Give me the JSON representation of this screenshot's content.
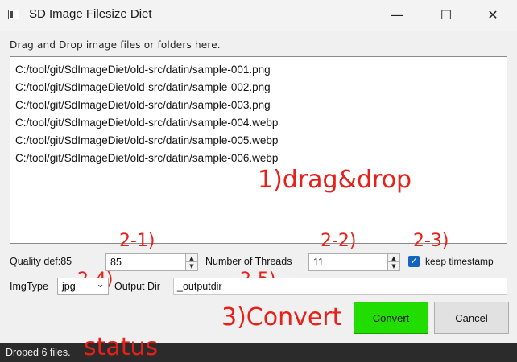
{
  "window": {
    "title": "SD Image Filesize Diet",
    "minimize_glyph": "—",
    "maximize_glyph": "☐",
    "close_glyph": "✕"
  },
  "drop_area": {
    "instruction": "Drag and Drop image files or folders here.",
    "files": [
      "C:/tool/git/SdImageDiet/old-src/datin/sample-001.png",
      "C:/tool/git/SdImageDiet/old-src/datin/sample-002.png",
      "C:/tool/git/SdImageDiet/old-src/datin/sample-003.png",
      "C:/tool/git/SdImageDiet/old-src/datin/sample-004.webp",
      "C:/tool/git/SdImageDiet/old-src/datin/sample-005.webp",
      "C:/tool/git/SdImageDiet/old-src/datin/sample-006.webp"
    ]
  },
  "annotations": {
    "drag_drop": "1)drag&drop",
    "quality": "2-1)",
    "threads": "2-2)",
    "timestamp": "2-3)",
    "imgtype": "2-4)",
    "outputdir": "2-5)",
    "convert": "3)Convert",
    "status": "status"
  },
  "settings": {
    "quality_label": "Quality def:85",
    "quality_value": "85",
    "threads_label": "Number of Threads",
    "threads_value": "11",
    "keep_timestamp_label": "keep timestamp",
    "keep_timestamp_checked": true,
    "imgtype_label": "ImgType",
    "imgtype_value": "jpg",
    "output_dir_label": "Output Dir",
    "output_dir_value": "_outputdir"
  },
  "actions": {
    "convert_label": "Convert",
    "cancel_label": "Cancel"
  },
  "status": {
    "text": "Droped 6 files."
  },
  "colors": {
    "annotation": "#e8201a",
    "convert_button": "#22dd00",
    "checkbox": "#1565c0",
    "statusbar": "#2b2b2b"
  },
  "icons": {
    "spin_up": "▲",
    "spin_down": "▼",
    "dropdown": "⌄",
    "check": "✓"
  }
}
